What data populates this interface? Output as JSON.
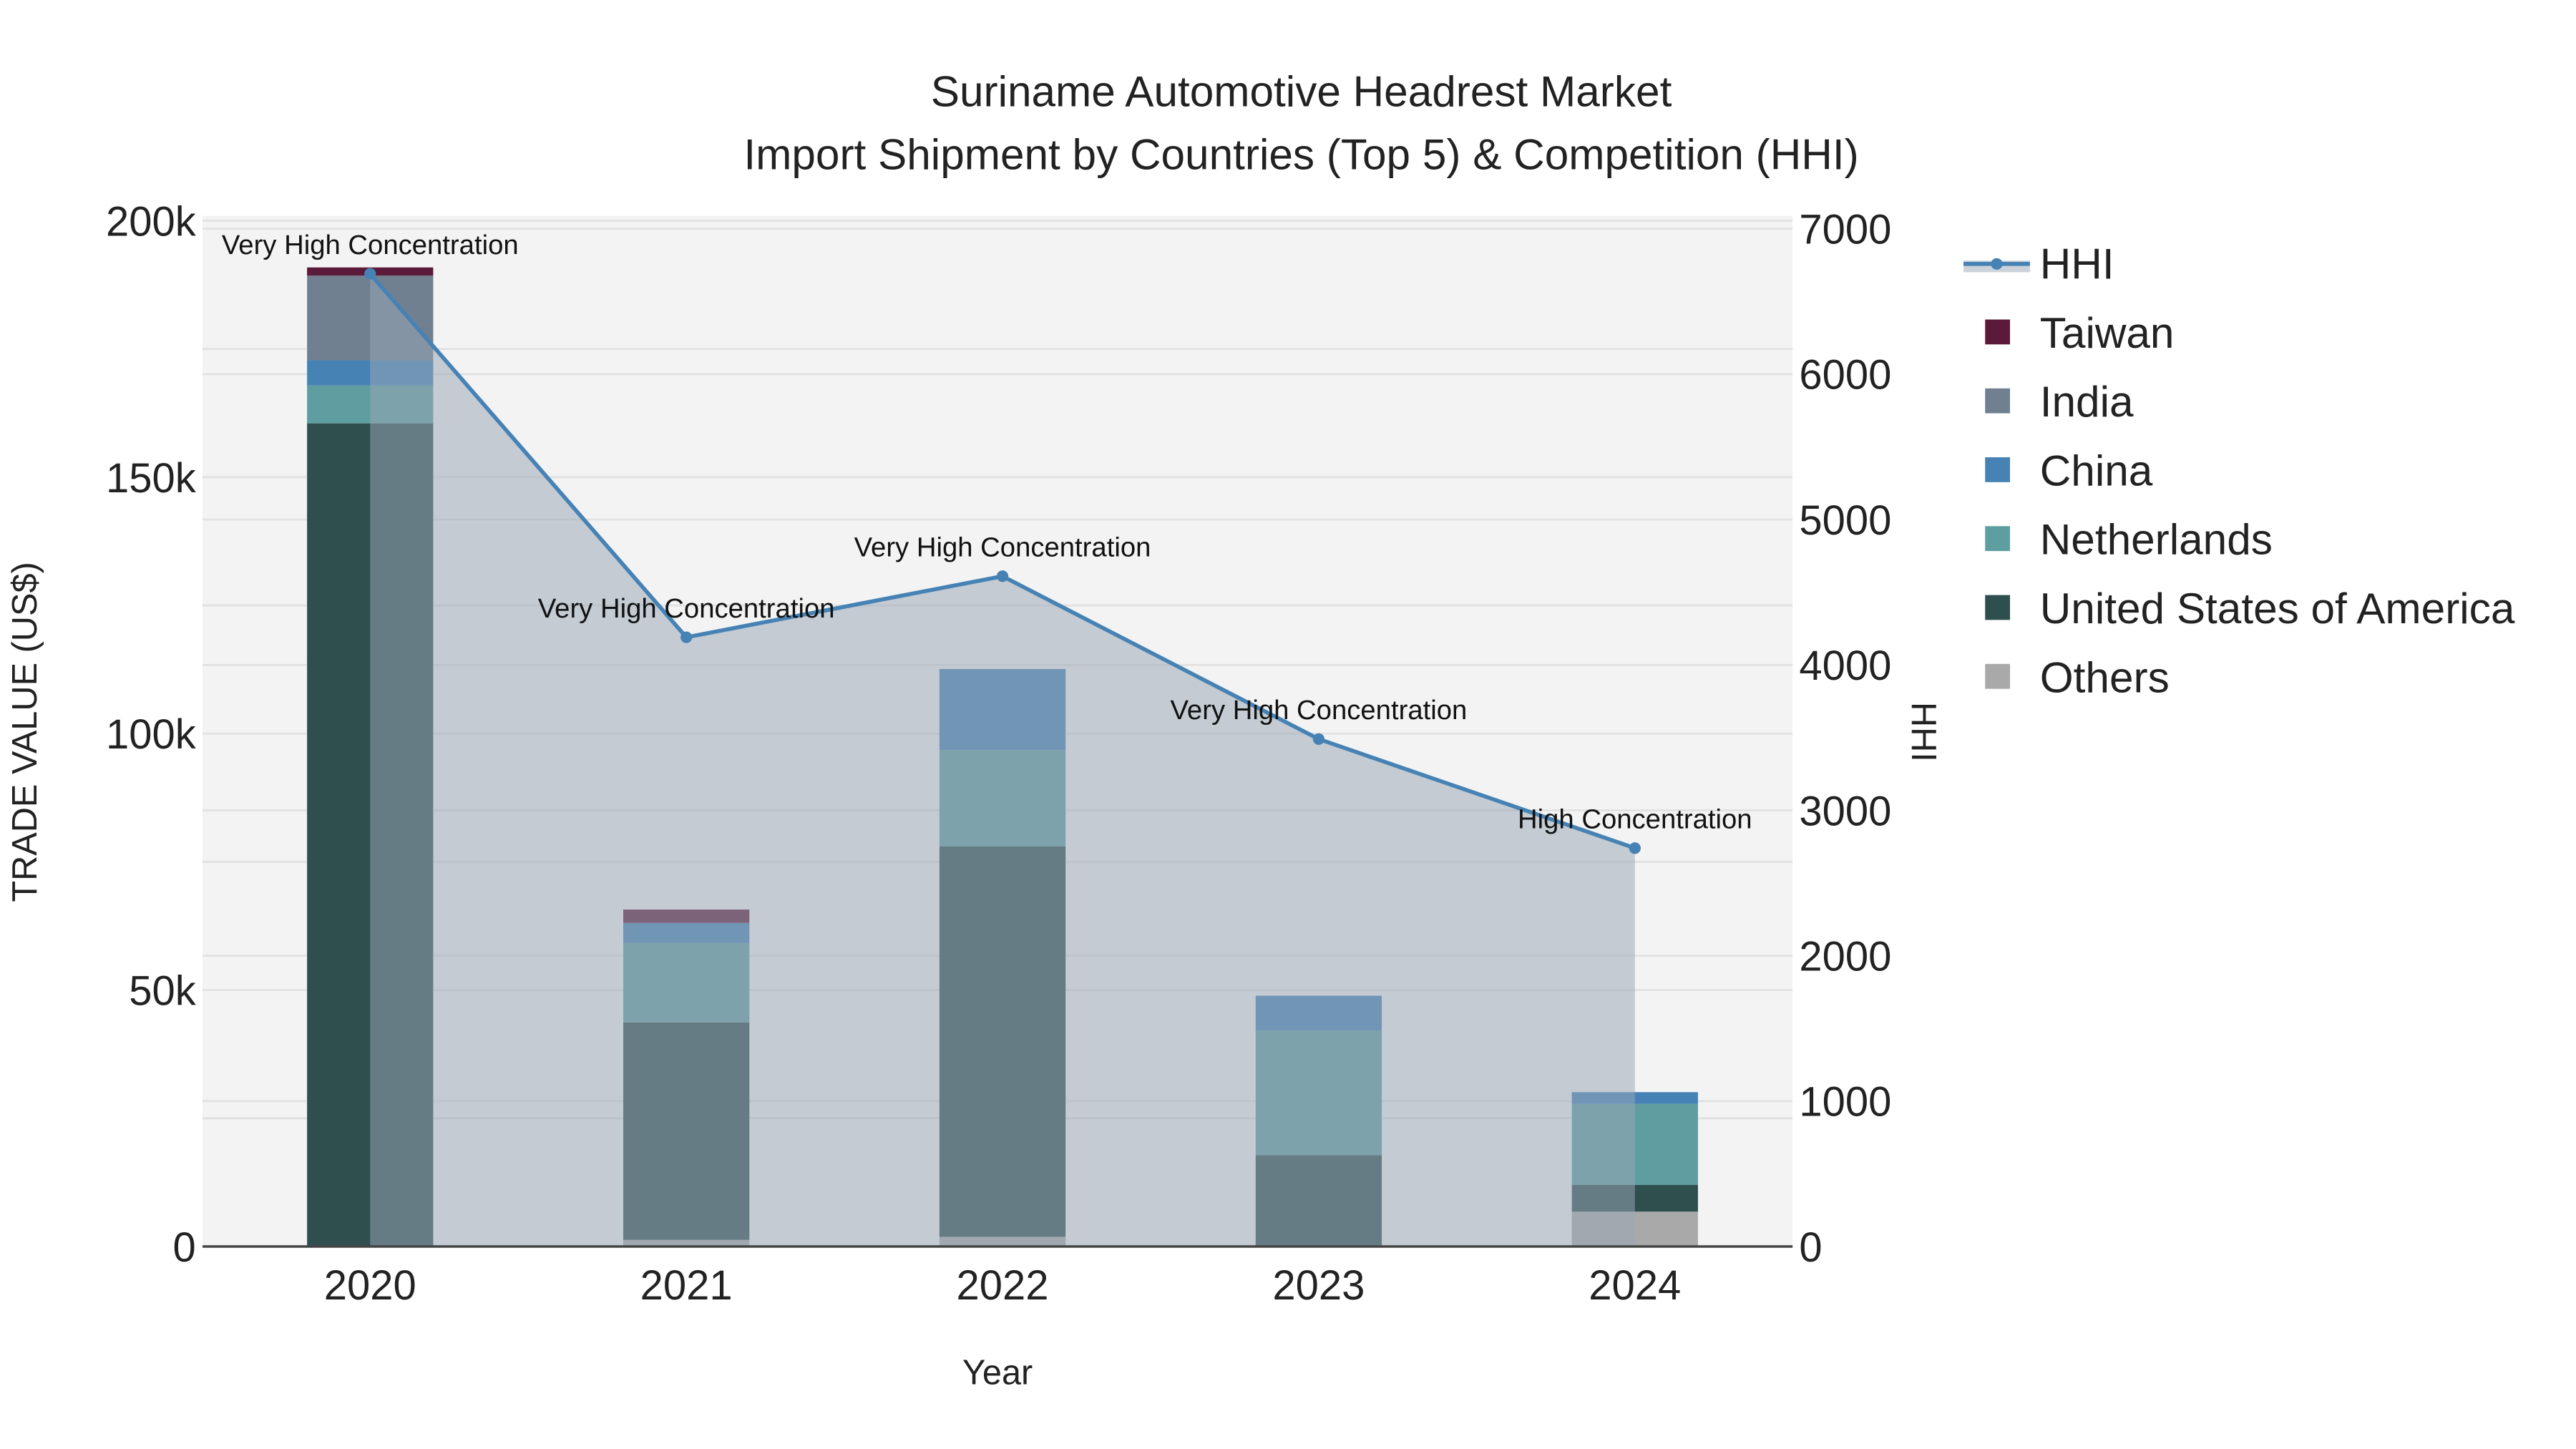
{
  "chart_data": {
    "type": "bar",
    "title": "Suriname Automotive Headrest Market",
    "subtitle": "Import Shipment by Countries (Top 5) & Competition (HHI)",
    "xlabel": "Year",
    "ylabel": "TRADE VALUE (US$)",
    "y2label": "HHI",
    "categories": [
      "2020",
      "2021",
      "2022",
      "2023",
      "2024"
    ],
    "ylim": [
      0,
      200000
    ],
    "y2lim": [
      0,
      7000
    ],
    "yticks": [
      {
        "v": 0,
        "label": "0"
      },
      {
        "v": 50000,
        "label": "50k"
      },
      {
        "v": 100000,
        "label": "100k"
      },
      {
        "v": 150000,
        "label": "150k"
      },
      {
        "v": 200000,
        "label": "200k"
      }
    ],
    "y2ticks": [
      "0",
      "1000",
      "2000",
      "3000",
      "4000",
      "5000",
      "6000",
      "7000"
    ],
    "stacked": true,
    "series": [
      {
        "name": "Others",
        "color": "#a9a9a9",
        "values": [
          0,
          1300,
          1900,
          0,
          6800
        ]
      },
      {
        "name": "United States of America",
        "color": "#2f4f4f",
        "values": [
          160500,
          42400,
          76100,
          17800,
          5200
        ]
      },
      {
        "name": "Netherlands",
        "color": "#5f9ea0",
        "values": [
          7400,
          15500,
          18800,
          24300,
          15800
        ]
      },
      {
        "name": "China",
        "color": "#4682b4",
        "values": [
          4900,
          3900,
          15800,
          6800,
          2300
        ]
      },
      {
        "name": "India",
        "color": "#708090",
        "values": [
          16500,
          0,
          0,
          0,
          0
        ]
      },
      {
        "name": "Taiwan",
        "color": "#5c1a3a",
        "values": [
          1600,
          2600,
          0,
          0,
          0
        ]
      }
    ],
    "hhi": {
      "name": "HHI",
      "color": "#4682b4",
      "values": [
        6690,
        4190,
        4610,
        3490,
        2740
      ],
      "labels": [
        "Very High Concentration",
        "Very High Concentration",
        "Very High Concentration",
        "Very High Concentration",
        "High Concentration"
      ]
    },
    "legend": [
      "HHI",
      "Taiwan",
      "India",
      "China",
      "Netherlands",
      "United States of America",
      "Others"
    ],
    "legend_position": "right",
    "grid": true
  }
}
